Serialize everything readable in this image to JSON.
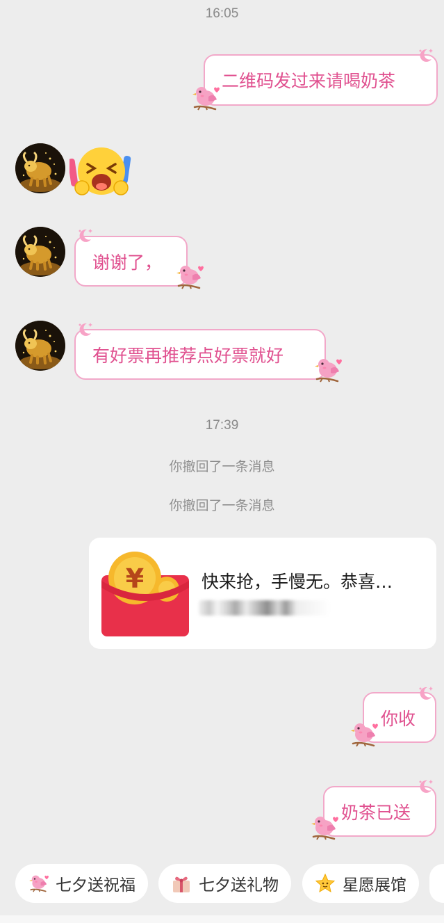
{
  "timestamps": [
    "16:05",
    "17:39"
  ],
  "messages": {
    "m1": "二维码发过来请喝奶茶",
    "m3": "谢谢了，",
    "m4": "有好票再推荐点好票就好",
    "m5": "你收",
    "m6": "奶茶已送"
  },
  "system_notes": [
    "你撤回了一条消息",
    "你撤回了一条消息"
  ],
  "red_packet": {
    "title": "快来抢，手慢无。恭喜…"
  },
  "quick_actions": [
    {
      "label": "七夕送祝福",
      "icon": "bird-icon"
    },
    {
      "label": "七夕送礼物",
      "icon": "gift-icon"
    },
    {
      "label": "星愿展馆",
      "icon": "star-icon"
    }
  ],
  "colors": {
    "background": "#ededed",
    "bubble_border": "#f2a8c9",
    "bubble_text": "#e0508f",
    "red_packet": "#e8304a"
  }
}
